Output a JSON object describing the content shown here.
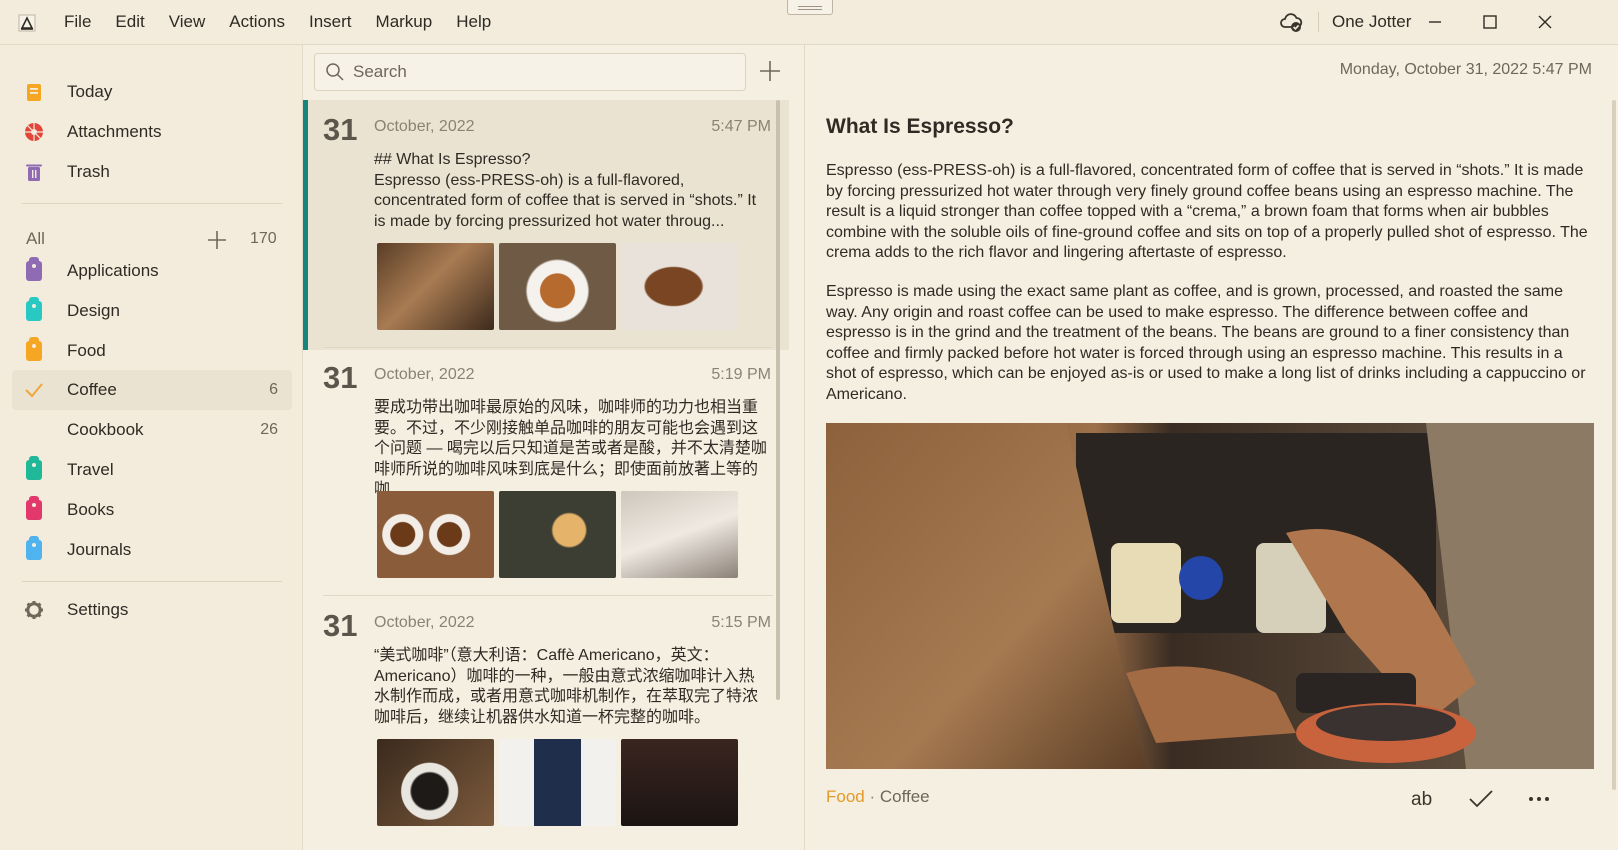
{
  "menu": [
    "File",
    "Edit",
    "View",
    "Actions",
    "Insert",
    "Markup",
    "Help"
  ],
  "account": "One Jotter",
  "sidebar": {
    "top": [
      {
        "label": "Today",
        "icon": "today-icon"
      },
      {
        "label": "Attachments",
        "icon": "attachments-icon"
      },
      {
        "label": "Trash",
        "icon": "trash-icon"
      }
    ],
    "all_label": "All",
    "all_count": "170",
    "notebooks": [
      {
        "label": "Applications",
        "color": "#8e6bb3",
        "count": ""
      },
      {
        "label": "Design",
        "color": "#27c9c2",
        "count": ""
      },
      {
        "label": "Food",
        "color": "#f5a623",
        "count": ""
      },
      {
        "label": "Coffee",
        "color": "#f0a63a",
        "count": "6"
      },
      {
        "label": "Cookbook",
        "color": "",
        "count": "26"
      },
      {
        "label": "Travel",
        "color": "#1fb99a",
        "count": ""
      },
      {
        "label": "Books",
        "color": "#e2386b",
        "count": ""
      },
      {
        "label": "Journals",
        "color": "#4fb3f0",
        "count": ""
      }
    ],
    "settings": "Settings"
  },
  "list": {
    "search_placeholder": "Search",
    "notes": [
      {
        "day": "31",
        "month": "October, 2022",
        "time": "5:47 PM",
        "excerpt": "## What Is Espresso?\nEspresso (ess-PRESS-oh) is a full-flavored, concentrated form of coffee that is served in “shots.” It is made by forcing pressurized hot water throug..."
      },
      {
        "day": "31",
        "month": "October, 2022",
        "time": "5:19 PM",
        "excerpt": "要成功带出咖啡最原始的风味，咖啡师的功力也相当重要。不过，不少刚接触单品咖啡的朋友可能也会遇到这个问题 — 喝完以后只知道是苦或者是酸，并不太清楚咖啡师所说的咖啡风味到底是什么；即使面前放著上等的咖..."
      },
      {
        "day": "31",
        "month": "October, 2022",
        "time": "5:15 PM",
        "excerpt": "“美式咖啡”（意大利语：Caffè Americano，英文：Americano）咖啡的一种，一般由意式浓缩咖啡计入热水制作而成，或者用意式咖啡机制作，在萃取完了特浓咖啡后，继续让机器供水知道一杯完整的咖啡。"
      }
    ]
  },
  "editor": {
    "date": "Monday, October 31, 2022  5:47 PM",
    "title": "What Is Espresso?",
    "para1": "Espresso (ess-PRESS-oh) is a full-flavored, concentrated form of coffee that is served in “shots.” It is made by forcing pressurized hot water through very finely ground coffee beans using an espresso machine. The result is a liquid stronger than coffee topped with a “crema,” a brown foam that forms when air bubbles combine with the soluble oils of fine-ground coffee and sits on top of a properly pulled shot of espresso. The crema adds to the rich flavor and lingering aftertaste of espresso.",
    "para2": "Espresso is made using the exact same plant as coffee, and is grown, processed, and roasted the same way. Any origin and roast coffee can be used to make espresso. The difference between coffee and espresso is in the grind and the treatment of the beans. The beans are ground to a finer consistency than coffee and firmly packed before hot water is forced through using an espresso machine. This results in a shot of espresso, which can be enjoyed as-is or used to make a long list of drinks including a cappuccino or Americano.",
    "tag_food": "Food",
    "tag_sep": " · ",
    "tag_coffee": "Coffee"
  }
}
